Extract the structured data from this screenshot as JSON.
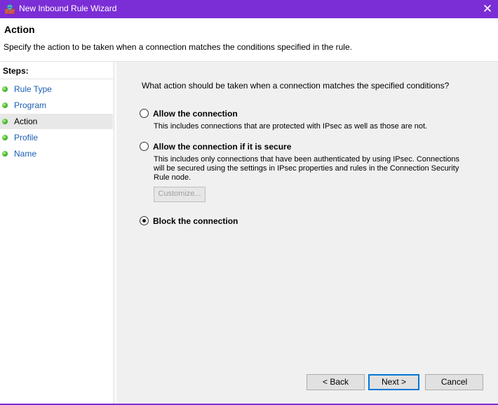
{
  "window": {
    "title": "New Inbound Rule Wizard",
    "close_glyph": "✕",
    "icon": "firewall-icon"
  },
  "header": {
    "title": "Action",
    "description": "Specify the action to be taken when a connection matches the conditions specified in the rule."
  },
  "sidebar": {
    "heading": "Steps:",
    "items": [
      {
        "label": "Rule Type"
      },
      {
        "label": "Program"
      },
      {
        "label": "Action"
      },
      {
        "label": "Profile"
      },
      {
        "label": "Name"
      }
    ],
    "selected_item": "Action"
  },
  "main": {
    "question": "What action should be taken when a connection matches the specified conditions?",
    "options": [
      {
        "label": "Allow the connection",
        "description": "This includes connections that are protected with IPsec as well as those are not."
      },
      {
        "label": "Allow the connection if it is secure",
        "description": "This includes only connections that have been authenticated by using IPsec.  Connections will be secured using the settings in IPsec properties and rules in the Connection Security Rule node."
      },
      {
        "label": "Block the connection",
        "description": ""
      }
    ],
    "selected_option": "Block the connection",
    "customize_label": "Customize..."
  },
  "buttons": {
    "back": "< Back",
    "next": "Next >",
    "cancel": "Cancel"
  },
  "colors": {
    "titlebar": "#7b2ed6",
    "content_bg": "#f0f0f0",
    "link": "#1a5fb4",
    "step_dot": "#45b82b"
  }
}
